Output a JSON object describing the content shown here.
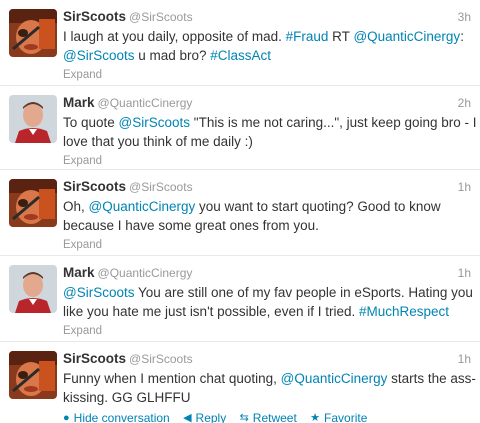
{
  "tweets": [
    {
      "fullname": "SirScoots",
      "username": "@SirScoots",
      "time": "3h",
      "line1": [
        {
          "t": "I laugh at you daily, opposite of mad. ",
          "k": "plain"
        },
        {
          "t": "#Fraud",
          "k": "hash"
        },
        {
          "t": " RT ",
          "k": "plain"
        },
        {
          "t": "@QuanticCinergy",
          "k": "link"
        },
        {
          "t": ":",
          "k": "plain"
        }
      ],
      "line2": [
        {
          "t": "@SirScoots",
          "k": "link"
        },
        {
          "t": " u mad bro? ",
          "k": "plain"
        },
        {
          "t": "#ClassAct",
          "k": "hash"
        }
      ],
      "expand": "Expand"
    },
    {
      "fullname": "Mark",
      "username": "@QuanticCinergy",
      "time": "2h",
      "line1": [
        {
          "t": "To quote ",
          "k": "plain"
        },
        {
          "t": "@SirScoots",
          "k": "link"
        },
        {
          "t": " \"This is me not caring...\", just keep going bro - I",
          "k": "plain"
        }
      ],
      "line2": [
        {
          "t": "love that you think of me daily :)",
          "k": "plain"
        }
      ],
      "expand": "Expand"
    },
    {
      "fullname": "SirScoots",
      "username": "@SirScoots",
      "time": "1h",
      "line1": [
        {
          "t": "Oh, ",
          "k": "plain"
        },
        {
          "t": "@QuanticCinergy",
          "k": "link"
        },
        {
          "t": " you want to start quoting? Good to know",
          "k": "plain"
        }
      ],
      "line2": [
        {
          "t": "because I have some great ones from you.",
          "k": "plain"
        }
      ],
      "expand": "Expand"
    },
    {
      "fullname": "Mark",
      "username": "@QuanticCinergy",
      "time": "1h",
      "line1": [
        {
          "t": "@SirScoots",
          "k": "link"
        },
        {
          "t": " You are still one of my fav people in eSports. Hating you",
          "k": "plain"
        }
      ],
      "line2": [
        {
          "t": "like you hate me just isn't possible, even if I tried. ",
          "k": "plain"
        },
        {
          "t": "#MuchRespect",
          "k": "hash"
        }
      ],
      "expand": "Expand"
    },
    {
      "fullname": "SirScoots",
      "username": "@SirScoots",
      "time": "1h",
      "line1": [
        {
          "t": "Funny when I mention chat quoting, ",
          "k": "plain"
        },
        {
          "t": "@QuanticCinergy",
          "k": "link"
        },
        {
          "t": " starts the ass-",
          "k": "plain"
        }
      ],
      "line2": [
        {
          "t": "kissing. GG GLHFFU",
          "k": "plain"
        }
      ]
    }
  ],
  "actions": {
    "hide": "Hide conversation",
    "reply": "Reply",
    "retweet": "Retweet",
    "favorite": "Favorite"
  },
  "colors": {
    "link": "#0084b4",
    "meta": "#999999",
    "text": "#333333"
  }
}
